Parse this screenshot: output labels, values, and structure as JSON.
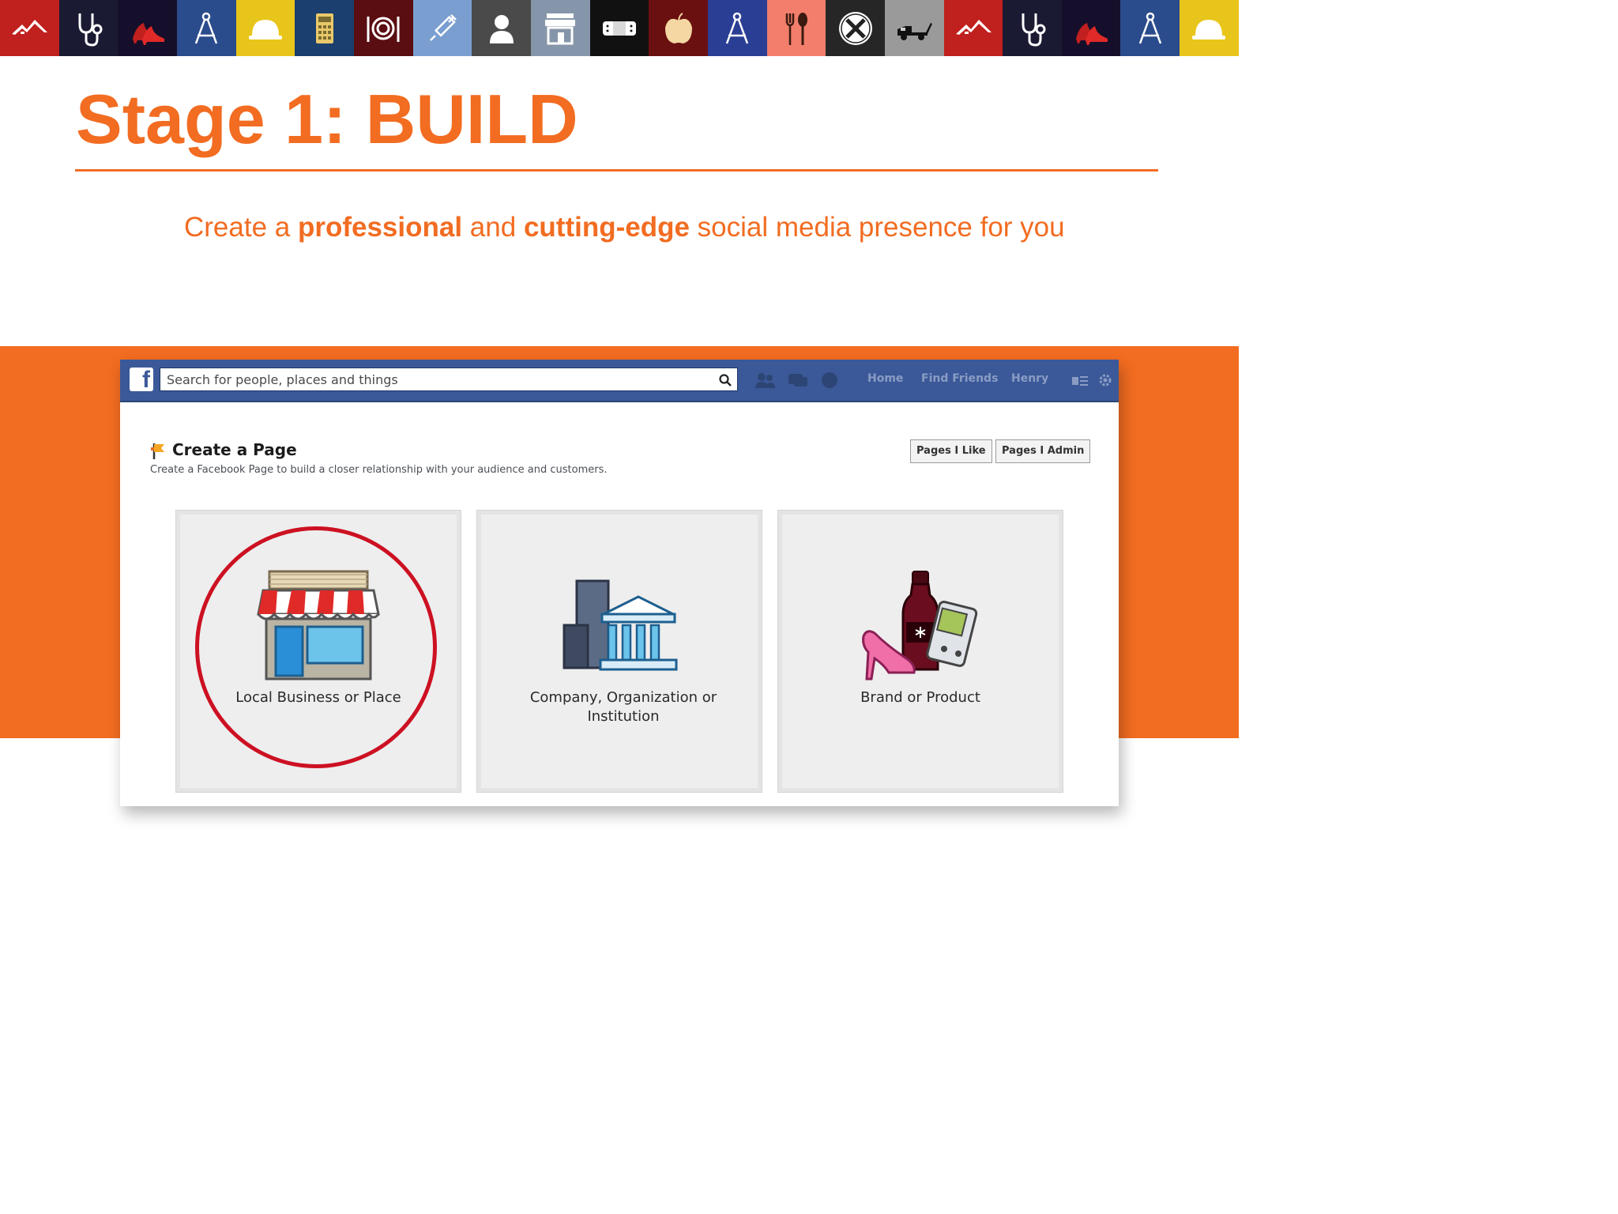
{
  "slide": {
    "title": "Stage 1: BUILD",
    "subtitle_parts": [
      "Create a ",
      "professional",
      " and ",
      "cutting-edge",
      " social media presence for you"
    ],
    "accent_color": "#f26c21"
  },
  "icon_strip": [
    {
      "icon": "roof-icon",
      "bg": "#c0201e"
    },
    {
      "icon": "stethoscope-icon",
      "bg": "#1a1a33"
    },
    {
      "icon": "high-heels-icon",
      "bg": "#160f2b"
    },
    {
      "icon": "drafting-compass-icon",
      "bg": "#2b4c8c"
    },
    {
      "icon": "hard-hat-icon",
      "bg": "#e8c51a"
    },
    {
      "icon": "calculator-icon",
      "bg": "#1b3f6e"
    },
    {
      "icon": "dinner-plate-icon",
      "bg": "#5a0e12"
    },
    {
      "icon": "syringe-icon",
      "bg": "#7a9ed0"
    },
    {
      "icon": "person-icon",
      "bg": "#4a4a4a"
    },
    {
      "icon": "storefront-icon",
      "bg": "#8696aa"
    },
    {
      "icon": "bandage-icon",
      "bg": "#111111"
    },
    {
      "icon": "apple-icon",
      "bg": "#6b1010"
    },
    {
      "icon": "drafting-compass-icon",
      "bg": "#2a3f94"
    },
    {
      "icon": "fork-spoon-icon",
      "bg": "#f27e6b"
    },
    {
      "icon": "tools-icon",
      "bg": "#262626"
    },
    {
      "icon": "tow-truck-icon",
      "bg": "#9a9a9a"
    },
    {
      "icon": "roof-icon",
      "bg": "#c0201e"
    },
    {
      "icon": "stethoscope-icon",
      "bg": "#1a1a33"
    },
    {
      "icon": "high-heels-icon",
      "bg": "#160f2b"
    },
    {
      "icon": "drafting-compass-icon",
      "bg": "#2b4c8c"
    },
    {
      "icon": "hard-hat-icon",
      "bg": "#e8c51a"
    }
  ],
  "facebook": {
    "logo": "f",
    "search_placeholder": "Search for people, places and things",
    "nav": [
      "Home",
      "Find Friends",
      "Henry"
    ],
    "create_page": {
      "title": "Create a Page",
      "description": "Create a Facebook Page to build a closer relationship with your audience and customers."
    },
    "buttons": [
      "Pages I Like",
      "Pages I Admin"
    ],
    "categories": [
      {
        "label": "Local Business or Place",
        "icon": "storefront-icon",
        "highlighted": true
      },
      {
        "label": "Company, Organization or Institution",
        "icon": "company-building-icon",
        "highlighted": false
      },
      {
        "label": "Brand or Product",
        "icon": "brand-product-icon",
        "highlighted": false
      }
    ],
    "highlight_color": "#cc1122",
    "header_color": "#3b5998"
  }
}
